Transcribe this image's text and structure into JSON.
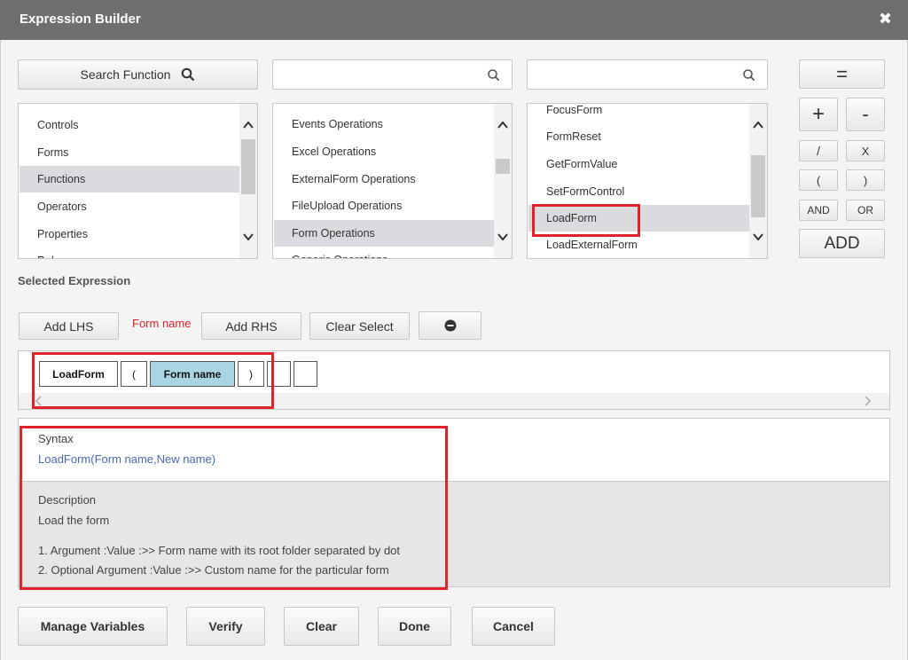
{
  "dialog": {
    "title": "Expression Builder",
    "close_glyph": "✖"
  },
  "search": {
    "button_label": "Search Function",
    "input1_value": "",
    "input2_value": ""
  },
  "categories": [
    "Controls",
    "Forms",
    "Functions",
    "Operators",
    "Properties",
    "Rules"
  ],
  "operations": [
    "Events Operations",
    "Excel Operations",
    "ExternalForm Operations",
    "FileUpload Operations",
    "Form Operations",
    "Generic Operations"
  ],
  "functions": [
    "FocusForm",
    "FormReset",
    "GetFormValue",
    "SetFormControl",
    "LoadForm",
    "LoadExternalForm"
  ],
  "operators": {
    "equals": "=",
    "plus": "+",
    "minus": "-",
    "divide": "/",
    "multiply": "X",
    "open_paren": "(",
    "close_paren": ")",
    "and": "AND",
    "or": "OR",
    "add": "ADD"
  },
  "selected_expression": {
    "label": "Selected Expression",
    "add_lhs": "Add LHS",
    "hint": "Form name",
    "add_rhs": "Add RHS",
    "clear_select": "Clear Select",
    "tokens": [
      "LoadForm",
      "(",
      "Form name",
      ")",
      "",
      ""
    ]
  },
  "info": {
    "syntax_label": "Syntax",
    "syntax_value": "LoadForm(Form name,New name)",
    "description_label": "Description",
    "description_value": "Load the form",
    "arg1": "1. Argument :Value :>> Form name with its root folder separated by dot",
    "arg2": "2. Optional Argument :Value :>> Custom name for the particular form"
  },
  "footer": {
    "manage_variables": "Manage Variables",
    "verify": "Verify",
    "clear": "Clear",
    "done": "Done",
    "cancel": "Cancel"
  },
  "colors": {
    "titlebar": "#6f6f6f",
    "highlight_red": "#e0232b",
    "token_selected": "#a9d4e2",
    "syntax_blue": "#4a67b0"
  }
}
